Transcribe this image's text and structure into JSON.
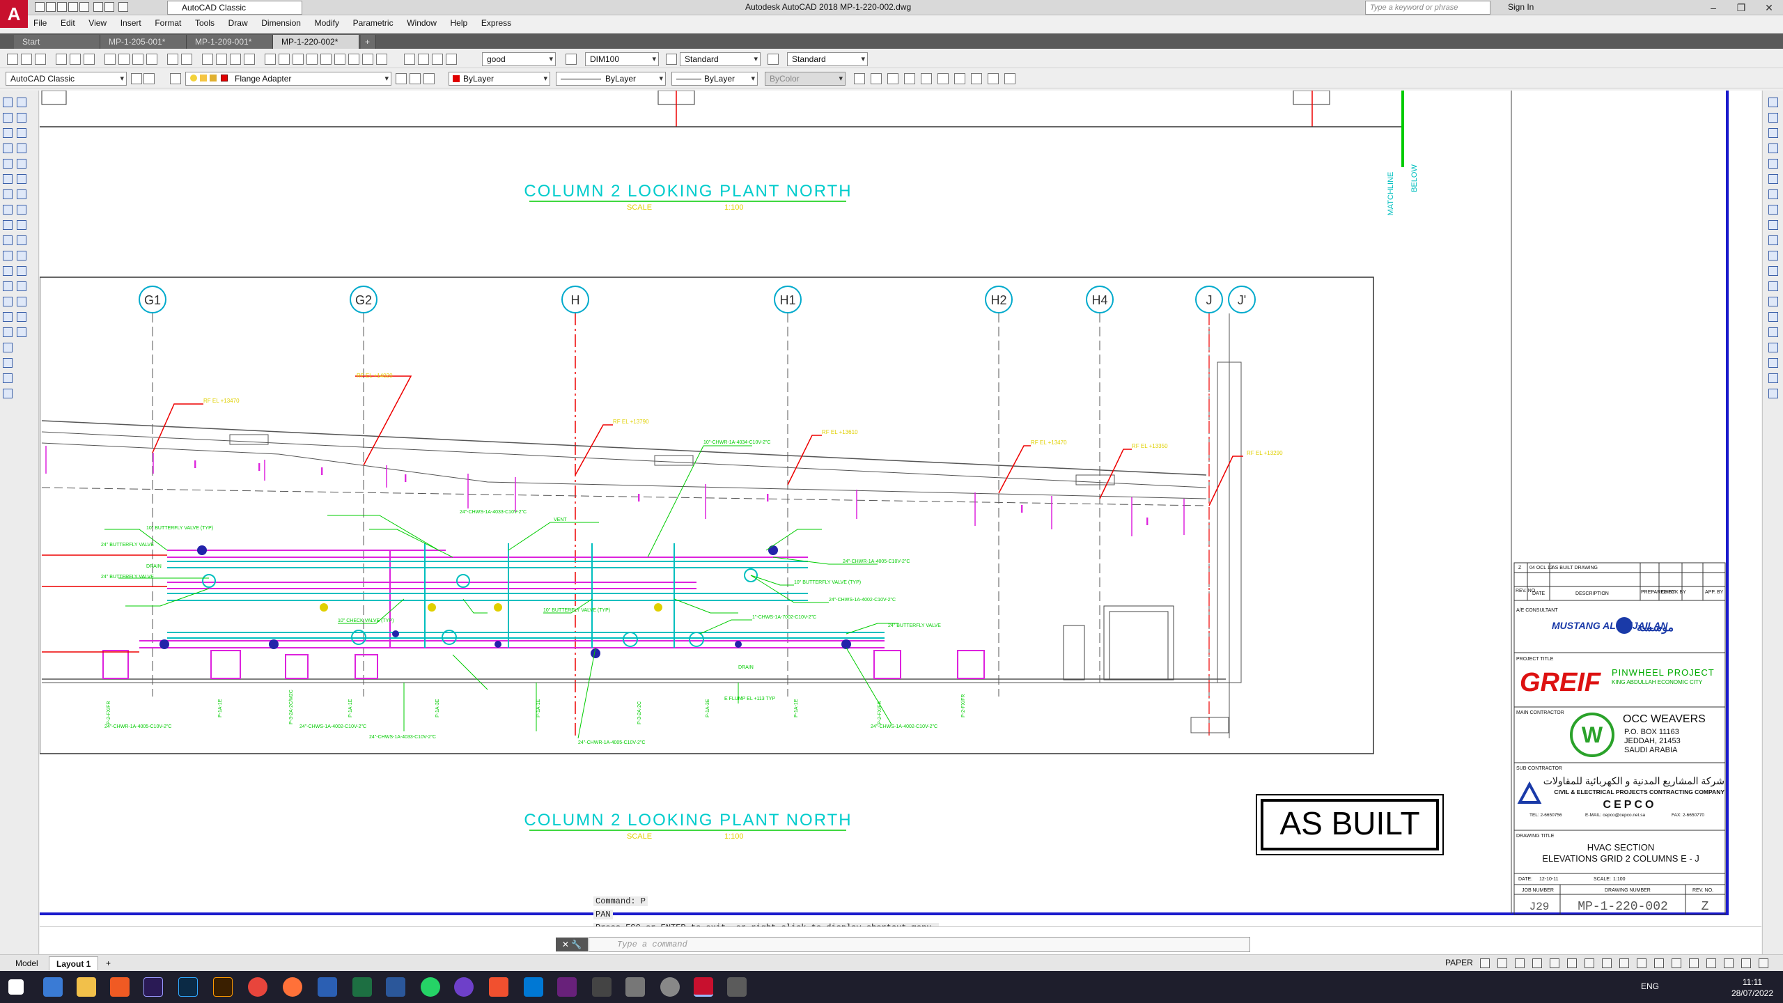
{
  "app": {
    "logo_letter": "A",
    "workspace": "AutoCAD Classic",
    "title": "Autodesk AutoCAD 2018    MP-1-220-002.dwg",
    "search_placeholder": "Type a keyword or phrase",
    "signin": "Sign In"
  },
  "menu": [
    "File",
    "Edit",
    "View",
    "Insert",
    "Format",
    "Tools",
    "Draw",
    "Dimension",
    "Modify",
    "Parametric",
    "Window",
    "Help",
    "Express"
  ],
  "tabs": [
    "Start",
    "MP-1-205-001*",
    "MP-1-209-001*",
    "MP-1-220-002*"
  ],
  "toolbar1": {
    "text_style": "good",
    "dim_style": "DIM100",
    "table_style": "Standard",
    "mleader_style": "Standard"
  },
  "toolbar2": {
    "workspace": "AutoCAD Classic",
    "layer": "Flange Adapter",
    "color": "ByLayer",
    "linetype": "ByLayer",
    "lineweight": "ByLayer",
    "plotstyle": "ByColor"
  },
  "drawing": {
    "view_title": "COLUMN 2 LOOKING PLANT NORTH",
    "scale_label": "SCALE",
    "scale_value": "1:100",
    "matchline": "MATCHLINE",
    "matchline_below": "BELOW",
    "grid_labels": [
      "G1",
      "G2",
      "H",
      "H1",
      "H2",
      "H4",
      "J",
      "J'"
    ],
    "as_built": "AS BUILT",
    "pipe_labels": [
      "10\"-CHWR-1A-4034-C10V-2\"C",
      "24\"-CHWS-1A-4033-C10V-2\"C",
      "24\" BUTTERFLY VALVE",
      "10\" BUTTERFLY VALVE (TYP)",
      "10\" CHECK VALVE (TYP)",
      "DRAIN",
      "VENT",
      "24\"-CHWR-1A-4005-C10V-2\"C",
      "1\"-CHWS-1A-7002-C10V-2\"C",
      "24\"-CHWS-1A-4002-C10V-2\"C",
      "E FLUMP EL +113 TYP"
    ]
  },
  "title_block": {
    "rev_row": {
      "rev": "Z",
      "date": "04 OCL 12",
      "desc": "AS BUILT DRAWING"
    },
    "rev_headers": [
      "REV. NO.",
      "DATE",
      "DESCRIPTION",
      "PREPARED BY",
      "CHECK BY",
      "APP. BY"
    ],
    "ae_consultant": "A/E CONSULTANT",
    "consultant_name": "MUSTANG AL-HEJAILAN",
    "project_title_label": "PROJECT TITLE",
    "client_logo": "GREIF",
    "project_name": "PINWHEEL PROJECT",
    "project_sub": "KING ABDULLAH ECONOMIC CITY",
    "main_contractor_label": "MAIN CONTRACTOR",
    "contractor_name": "OCC WEAVERS",
    "contractor_addr": [
      "P.O. BOX 11163",
      "JEDDAH, 21453",
      "SAUDI ARABIA"
    ],
    "sub_contractor_label": "SUB-CONTRACTOR",
    "sub_arabic": "شركة المشاريع المدنية و الكهربائية للمقاولات",
    "sub_name": "CIVIL & ELECTRICAL PROJECTS CONTRACTING COMPANY",
    "sub_abbr": "CEPCO",
    "sub_contacts": [
      "TEL: 2-6650756",
      "E-MAIL: cepco@cepco.net.sa",
      "FAX: 2-6650770"
    ],
    "drawing_title_label": "DRAWING TITLE",
    "drawing_title": [
      "HVAC SECTION",
      "ELEVATIONS GRID 2 COLUMNS E - J"
    ],
    "date_label": "DATE:",
    "date": "12-10-11",
    "scale_label": "SCALE:",
    "scale": "1:100",
    "job_label": "JOB NUMBER",
    "job": "J29",
    "dwgno_label": "DRAWING NUMBER",
    "dwgno": "MP-1-220-002",
    "rev_label": "REV. NO.",
    "rev": "Z"
  },
  "command": {
    "history1": "Command: P",
    "history2": "PAN",
    "history3": "Press ESC or ENTER to exit, or right-click to display shortcut menu.",
    "placeholder": "Type a command"
  },
  "layout_tabs": [
    "Model",
    "Layout 1"
  ],
  "status": {
    "space": "PAPER"
  },
  "system": {
    "lang": "ENG",
    "time": "11:11",
    "date": "28/07/2022"
  }
}
